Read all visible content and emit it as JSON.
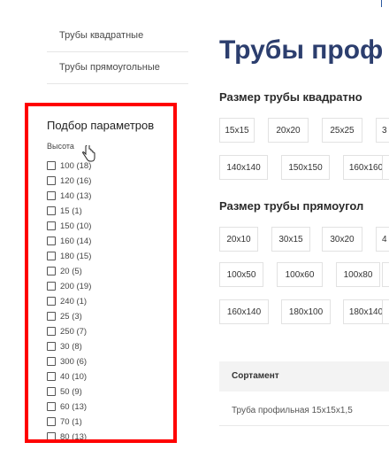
{
  "nav": {
    "items": [
      {
        "label": "Трубы квадратные"
      },
      {
        "label": "Трубы прямоугольные"
      }
    ]
  },
  "filter": {
    "title": "Подбор параметров",
    "group_label": "Высота",
    "options": [
      {
        "label": "100 (18)"
      },
      {
        "label": "120 (16)"
      },
      {
        "label": "140 (13)"
      },
      {
        "label": "15 (1)"
      },
      {
        "label": "150 (10)"
      },
      {
        "label": "160 (14)"
      },
      {
        "label": "180 (15)"
      },
      {
        "label": "20 (5)"
      },
      {
        "label": "200 (19)"
      },
      {
        "label": "240 (1)"
      },
      {
        "label": "25 (3)"
      },
      {
        "label": "250 (7)"
      },
      {
        "label": "30 (8)"
      },
      {
        "label": "300 (6)"
      },
      {
        "label": "40 (10)"
      },
      {
        "label": "50 (9)"
      },
      {
        "label": "60 (13)"
      },
      {
        "label": "70 (1)"
      },
      {
        "label": "80 (13)"
      }
    ],
    "highlight_color": "#ff0000"
  },
  "main": {
    "title": "Трубы проф",
    "square": {
      "heading": "Размер трубы квадратно",
      "chips": [
        "15x15",
        "20x20",
        "25x25",
        "3",
        "140x140",
        "150x150",
        "160x160",
        ""
      ]
    },
    "rect": {
      "heading": "Размер трубы прямоугол",
      "chips": [
        "20x10",
        "30x15",
        "30x20",
        "4",
        "100x50",
        "100x60",
        "100x80",
        "",
        "160x140",
        "180x100",
        "180x140",
        ""
      ]
    },
    "table": {
      "header": "Сортамент",
      "rows": [
        "Труба профильная 15x15x1,5"
      ]
    },
    "title_color": "#2c3e6e"
  }
}
